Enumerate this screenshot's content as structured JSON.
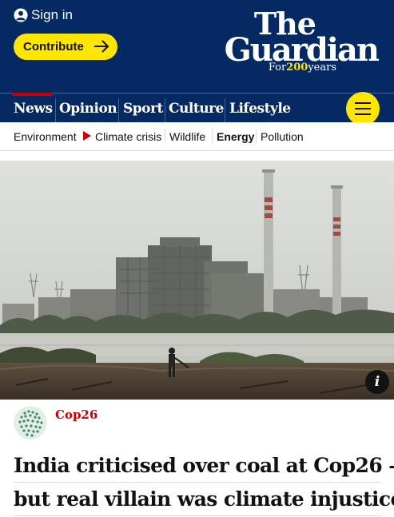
{
  "header": {
    "sign_in": "Sign in",
    "contribute_label": "Contribute",
    "logo": {
      "line1": "The",
      "line2": "Guardian",
      "tagline_prefix": "For",
      "tagline_number": "200",
      "tagline_suffix": "years"
    },
    "brand_color": "#052962",
    "accent_color": "#ffe500"
  },
  "nav": {
    "pillars": [
      "News",
      "Opinion",
      "Sport",
      "Culture",
      "Lifestyle"
    ],
    "active_pillar": "News",
    "menu_icon": "hamburger-icon"
  },
  "subnav": {
    "items": [
      "Environment",
      "Climate crisis",
      "Wildlife",
      "Energy",
      "Pollution"
    ],
    "active_item": "Energy"
  },
  "hero": {
    "info_label": "i"
  },
  "article": {
    "kicker": "Cop26",
    "kicker_color": "#c70000",
    "headline_lines": [
      "India criticised over coal at Cop26 –",
      "but real villain was climate injustice"
    ]
  }
}
